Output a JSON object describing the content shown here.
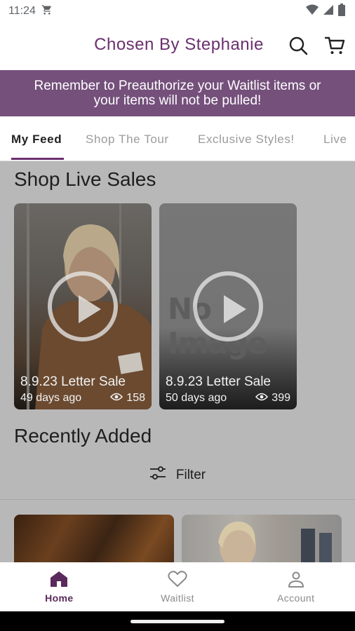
{
  "status_bar": {
    "time": "11:24",
    "icons": [
      "shopping-cart-icon",
      "wifi-icon",
      "signal-icon",
      "battery-icon"
    ]
  },
  "header": {
    "title": "Chosen By Stephanie",
    "icons": [
      "search-icon",
      "cart-icon"
    ],
    "title_color": "#6b2f6e"
  },
  "banner": {
    "text_line1": "Remember to Preauthorize your Waitlist items or",
    "text_line2": "your items will not be pulled!",
    "background": "#74507b"
  },
  "tabs": [
    {
      "label": "My Feed",
      "active": true
    },
    {
      "label": "Shop The Tour",
      "active": false
    },
    {
      "label": "Exclusive Styles!",
      "active": false
    },
    {
      "label": "Live",
      "active": false
    }
  ],
  "live_sales": {
    "title": "Shop Live Sales",
    "cards": [
      {
        "title": "8.9.23 Letter Sale",
        "age": "49 days ago",
        "views": "158"
      },
      {
        "title": "8.9.23 Letter Sale",
        "age": "50 days ago",
        "views": "399",
        "placeholder_text": "No Image"
      }
    ]
  },
  "recently_added": {
    "title": "Recently Added",
    "filter_label": "Filter"
  },
  "bottom_nav": [
    {
      "label": "Home",
      "icon": "home-icon",
      "active": true
    },
    {
      "label": "Waitlist",
      "icon": "heart-icon",
      "active": false
    },
    {
      "label": "Account",
      "icon": "account-icon",
      "active": false
    }
  ],
  "colors": {
    "accent": "#6b2f6e",
    "overlay": "#b8b8b8"
  }
}
